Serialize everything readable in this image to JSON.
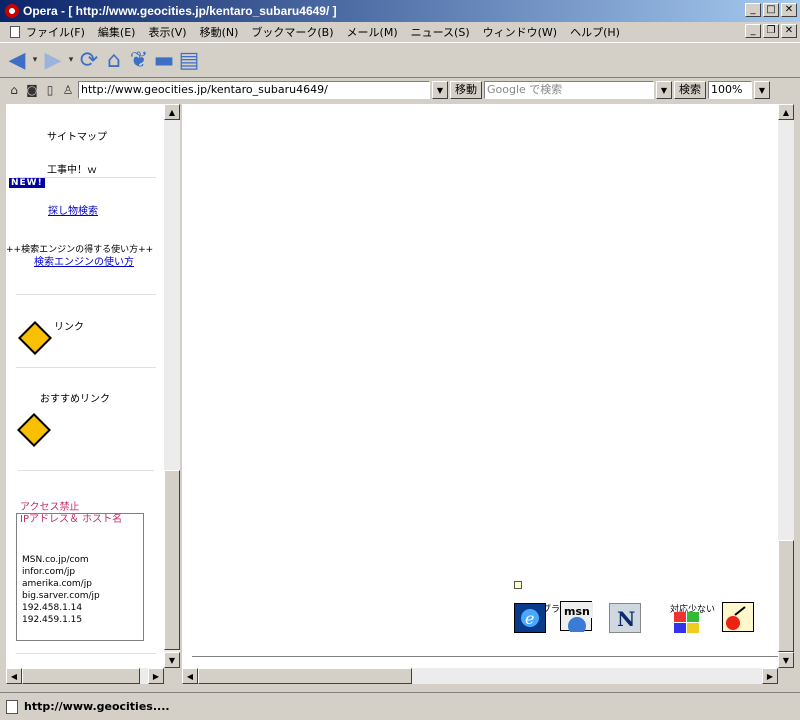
{
  "window": {
    "title": "Opera - [ http://www.geocities.jp/kentaro_subaru4649/ ]"
  },
  "menu": [
    "ファイル(F)",
    "編集(E)",
    "表示(V)",
    "移動(N)",
    "ブックマーク(B)",
    "メール(M)",
    "ニュース(S)",
    "ウィンドウ(W)",
    "ヘルプ(H)"
  ],
  "address": {
    "url": "http://www.geocities.jp/kentaro_subaru4649/",
    "go_label": "移動",
    "search_placeholder": "Google で検索",
    "search_label": "検索",
    "zoom": "100%"
  },
  "sidebar": {
    "sitemap": "サイトマップ",
    "construction": "工事中！ｗ",
    "new_badge": "NEW!",
    "search_link": "探し物検索",
    "search_engine_title": "++検索エンジンの得する使い方++",
    "search_engine_link": "検索エンジンの使い方",
    "links": "リンク",
    "recommended": "おすすめリンク",
    "access_ban": "アクセス禁止",
    "ip_host": "IPアドレス＆ ホスト名",
    "ip_list": [
      "MSN.co.jp/com",
      "infor.com/jp",
      "amerika.com/jp",
      "big.sarver.com/jp",
      "192.458.1.14",
      "192.459.1.15"
    ]
  },
  "main": {
    "browser_label": "ブラウザ",
    "compat_label": "対応少ない",
    "msn_text": "msn"
  },
  "status": {
    "text": "http://www.geocities...."
  },
  "colors": {
    "title_start": "#0a246a",
    "title_end": "#a6caf0",
    "link": "#0000cc",
    "pink": "#c0306a"
  }
}
